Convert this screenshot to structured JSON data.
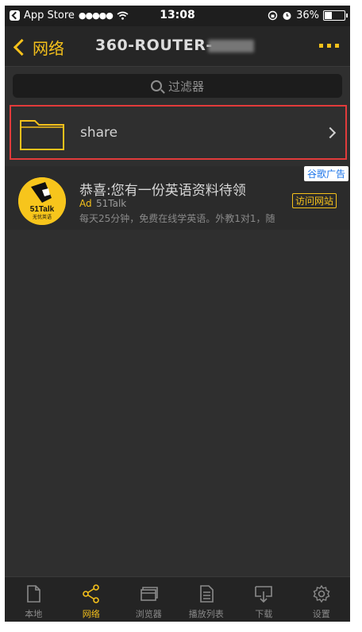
{
  "status_bar": {
    "carrier": "App Store",
    "signal": "●●●●●",
    "time": "13:08",
    "battery": "36%"
  },
  "nav": {
    "back_label": "网络",
    "title": "360-ROUTER-",
    "more_icon": "more-icon"
  },
  "search": {
    "placeholder": "过滤器"
  },
  "list": [
    {
      "name": "share",
      "icon": "folder-icon"
    }
  ],
  "ad": {
    "badge": "谷歌广告",
    "logo_text": "51Talk",
    "logo_sub": "无忧英语",
    "title": "恭喜:您有一份英语资料待领",
    "tag": "Ad",
    "brand": "51Talk",
    "desc": "每天25分钟，免费在线学英语。外教1对1，随",
    "visit": "访问网站"
  },
  "tabs": [
    {
      "label": "本地",
      "icon": "document-icon",
      "active": false
    },
    {
      "label": "网络",
      "icon": "share-icon",
      "active": true
    },
    {
      "label": "浏览器",
      "icon": "browser-icon",
      "active": false
    },
    {
      "label": "播放列表",
      "icon": "playlist-icon",
      "active": false
    },
    {
      "label": "下载",
      "icon": "download-icon",
      "active": false
    },
    {
      "label": "设置",
      "icon": "gear-icon",
      "active": false
    }
  ],
  "colors": {
    "accent": "#f5c11b",
    "background": "#2f2f2f",
    "highlight_border": "#e23b3b"
  }
}
